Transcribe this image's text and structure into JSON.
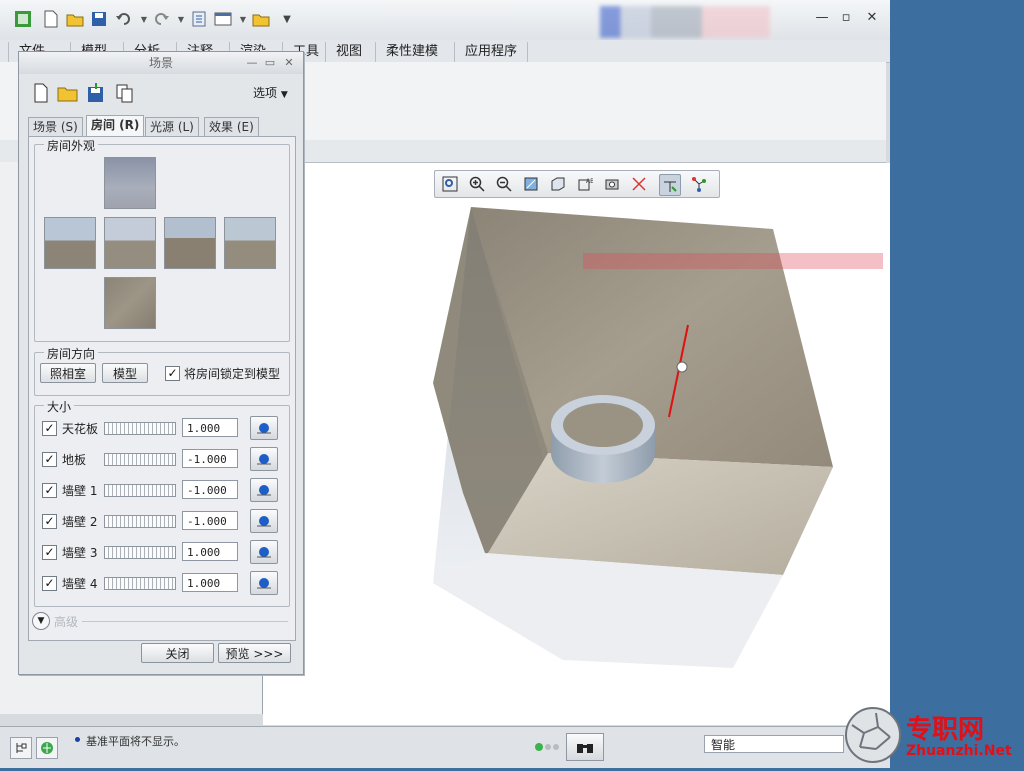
{
  "ribbon": {
    "tabs": [
      "文件",
      "模型",
      "分析",
      "注释",
      "渲染",
      "工具",
      "视图",
      "柔性建模",
      "应用程序"
    ]
  },
  "dialog": {
    "title": "场景",
    "options_label": "选项",
    "tabs": [
      "场景 (S)",
      "房间 (R)",
      "光源 (L)",
      "效果 (E)"
    ],
    "active_tab": "房间 (R)",
    "appearance_group": "房间外观",
    "orientation_group": "房间方向",
    "btn_studio": "照相室",
    "btn_model": "模型",
    "lock_label": "将房间锁定到模型",
    "size_group": "大小",
    "rows": [
      {
        "label": "天花板",
        "value": "1.000"
      },
      {
        "label": "地板",
        "value": "-1.000"
      },
      {
        "label": "墙壁 1",
        "value": "-1.000"
      },
      {
        "label": "墙壁 2",
        "value": "-1.000"
      },
      {
        "label": "墙壁 3",
        "value": "1.000"
      },
      {
        "label": "墙壁 4",
        "value": "1.000"
      }
    ],
    "advanced_label": "高级",
    "close_label": "关闭",
    "preview_label": "预览 >>>"
  },
  "status": {
    "message": "基准平面将不显示。",
    "filter_value": "智能"
  },
  "watermark": {
    "brand_cn": "专职网",
    "brand_en": "Zhuanzhi.Net"
  },
  "colors": {
    "desktop": "#3d6ea0",
    "accent": "#1a3fa8",
    "ring": "#a9b6c3",
    "axis": "#e01010"
  }
}
